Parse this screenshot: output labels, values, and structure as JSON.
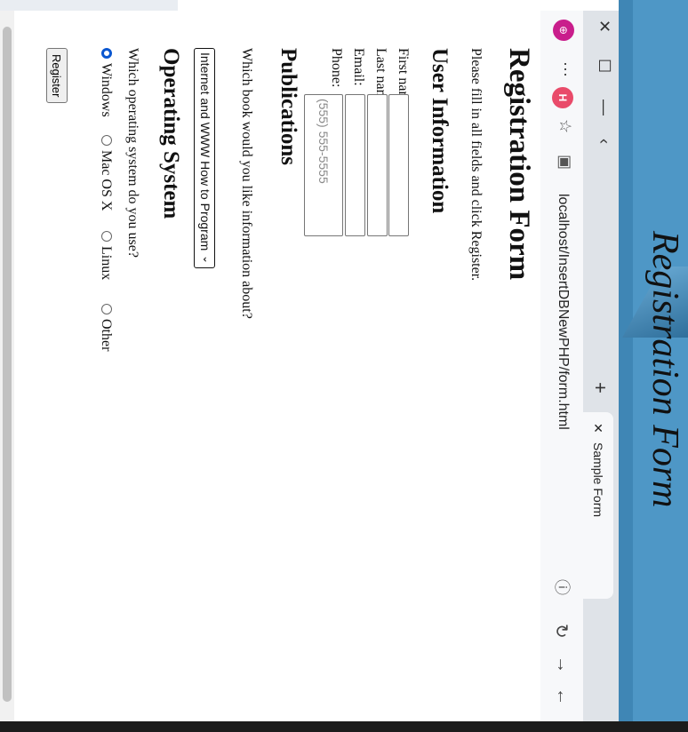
{
  "browser": {
    "tab_title": "Sample Form",
    "tab_close": "✕",
    "new_tab": "+",
    "url": "localhost/InsertDBNewPHP/form.html",
    "profile_initial": "H",
    "window_controls": [
      "—",
      "☐",
      "✕"
    ],
    "nav": {
      "back": "←",
      "forward": "→",
      "reload": "↻"
    },
    "icons": [
      "info-icon",
      "tab-search-icon",
      "favorite-star-icon",
      "menu-dots-icon",
      "extension-icon"
    ]
  },
  "page": {
    "title": "Registration Form",
    "intro": "Please fill in all fields and click Register.",
    "user_info_heading": "User Information",
    "labels": {
      "first_name": "First name:",
      "last_name": "Last name:",
      "email": "Email:",
      "phone": "Phone:"
    },
    "phone_placeholder": "(555) 555-5555",
    "publications_heading": "Publications",
    "publications_question": "Which book would you like information about?",
    "book_selected": "Internet and WWW How to Program",
    "os_heading": "Operating System",
    "os_question": "Which operating system do you use?",
    "os_options": [
      "Windows",
      "Mac OS X",
      "Linux",
      "Other"
    ],
    "os_selected": "Windows",
    "register_label": "Register"
  },
  "overlay": {
    "caption": "Registration Form"
  },
  "colors": {
    "accent_blue": "#0b57d0",
    "backdrop_blue": "#3f86b5",
    "profile_pink": "#e94b6a"
  }
}
